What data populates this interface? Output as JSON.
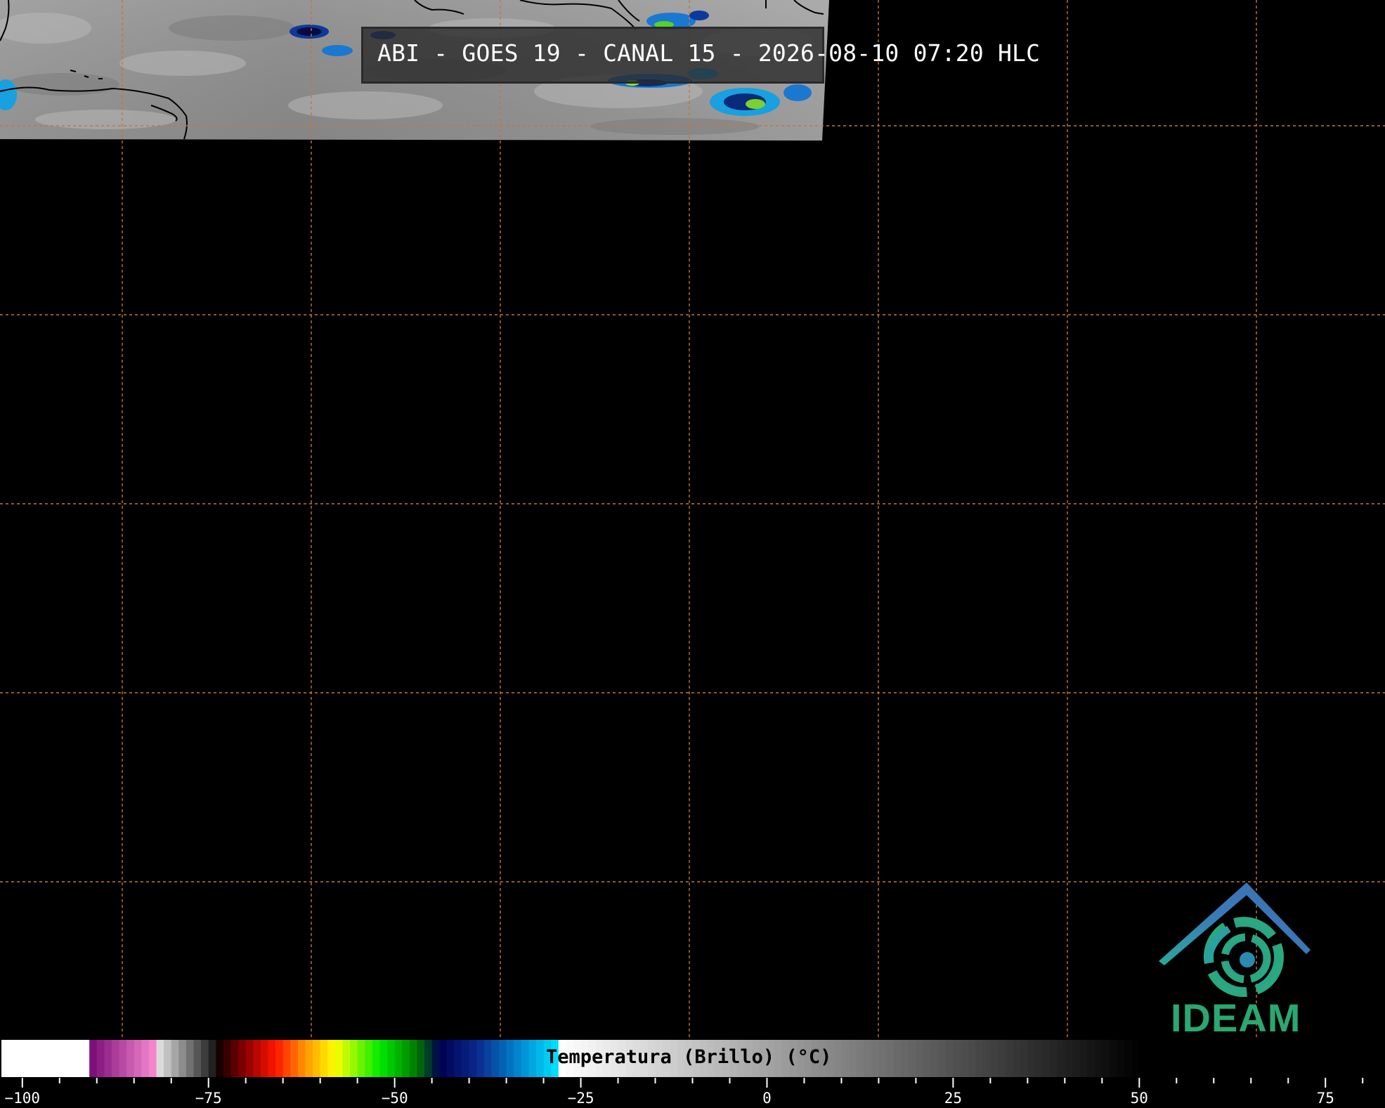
{
  "title": "ABI - GOES 19 - CANAL 15 - 2026-08-10 07:20 HLC",
  "colorbar": {
    "label": "Temperatura (Brillo) (°C)",
    "min": -103,
    "max": 83,
    "ticks": [
      {
        "value": -100,
        "label": "−100"
      },
      {
        "value": -75,
        "label": "−75"
      },
      {
        "value": -50,
        "label": "−50"
      },
      {
        "value": -25,
        "label": "−25"
      },
      {
        "value": 0,
        "label": "0"
      },
      {
        "value": 25,
        "label": "25"
      },
      {
        "value": 50,
        "label": "50"
      },
      {
        "value": 75,
        "label": "75"
      }
    ]
  },
  "logo": {
    "text": "IDEAM"
  },
  "colors": {
    "background": "#000000",
    "gridline": "#c8743a",
    "logo_blue": "#3a6fb0",
    "logo_green": "#2aa872"
  }
}
